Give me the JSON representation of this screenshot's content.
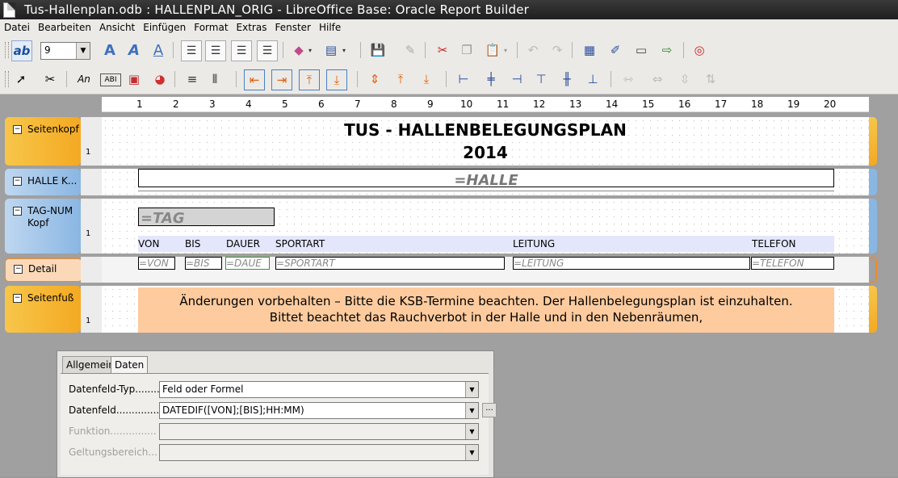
{
  "window": {
    "title": "Tus-Hallenplan.odb : HALLENPLAN_ORIG - LibreOffice Base: Oracle Report Builder"
  },
  "menu": [
    "Datei",
    "Bearbeiten",
    "Ansicht",
    "Einfügen",
    "Format",
    "Extras",
    "Fenster",
    "Hilfe"
  ],
  "toolbar1": {
    "font_size": "9",
    "icons": [
      "text-style-icon",
      "fontwork-shadow-icon",
      "fontwork-italic-icon",
      "fontwork-underline-icon",
      "align-left-icon",
      "align-center-icon",
      "align-right-icon",
      "align-justify-icon",
      "shapes-icon",
      "shapes-dropdown-icon",
      "list-icon",
      "list-dropdown-icon",
      "save-icon",
      "edit-icon",
      "cut-icon",
      "copy-icon",
      "paste-icon",
      "paste-dropdown-icon",
      "undo-icon",
      "redo-icon",
      "report-navigator-icon",
      "sort-icon",
      "page-header-icon",
      "add-field-icon",
      "help-icon"
    ]
  },
  "toolbar2": {
    "icons": [
      "select-icon",
      "controls-icon",
      "label-icon",
      "text-field-icon",
      "image-icon",
      "chart-icon",
      "horizontal-line-icon",
      "vertical-line-icon",
      "align-left-edge-icon",
      "align-right-edge-icon",
      "align-top-edge-icon",
      "align-bottom-edge-icon",
      "shrink-icon",
      "shrink-top-icon",
      "shrink-bottom-icon",
      "object-align-left-icon",
      "object-align-center-icon",
      "object-align-right-icon",
      "object-align-top-icon",
      "object-align-middle-icon",
      "object-align-bottom-icon",
      "same-width-icon",
      "same-height-icon",
      "same-both-icon",
      "smallest-icon"
    ]
  },
  "ruler": [
    "1",
    "2",
    "3",
    "4",
    "5",
    "6",
    "7",
    "8",
    "9",
    "10",
    "11",
    "12",
    "13",
    "14",
    "15",
    "16",
    "17",
    "18",
    "19",
    "20"
  ],
  "sections": {
    "seitenkopf": {
      "label": "Seitenkopf",
      "title_line1": "TUS - HALLENBELEGUNGSPLAN",
      "title_line2": "2014"
    },
    "halle": {
      "label": "HALLE K...",
      "field": "=HALLE"
    },
    "tagnum": {
      "label_line1": "TAG-NUM",
      "label_line2": "Kopf",
      "field": "=TAG",
      "columns": [
        "VON",
        "BIS",
        "DAUER",
        "SPORTART",
        "LEITUNG",
        "TELEFON"
      ]
    },
    "detail": {
      "label": "Detail",
      "fields": [
        "=VON",
        "=BIS",
        "=DAUE",
        "=SPORTART",
        "=LEITUNG",
        "=TELEFON"
      ]
    },
    "seitenfuss": {
      "label": "Seitenfuß",
      "line1": "Änderungen vorbehalten – Bitte die KSB-Termine beachten. Der Hallenbelegungsplan ist einzuhalten.",
      "line2": "Bittet beachtet das Rauchverbot in der Halle und in den Nebenräumen,"
    }
  },
  "vruler_marker": "1",
  "properties": {
    "tabs": [
      "Allgemein",
      "Daten"
    ],
    "active_tab": "Daten",
    "rows": [
      {
        "label": "Datenfeld-Typ.........",
        "value": "Feld oder Formel",
        "enabled": true
      },
      {
        "label": "Datenfeld..............",
        "value": "DATEDIF([VON];[BIS];HH:MM)",
        "enabled": true
      },
      {
        "label": "Funktion...............",
        "value": "",
        "enabled": false
      },
      {
        "label": "Geltungsbereich...",
        "value": "",
        "enabled": false
      }
    ],
    "more_button": "..."
  }
}
